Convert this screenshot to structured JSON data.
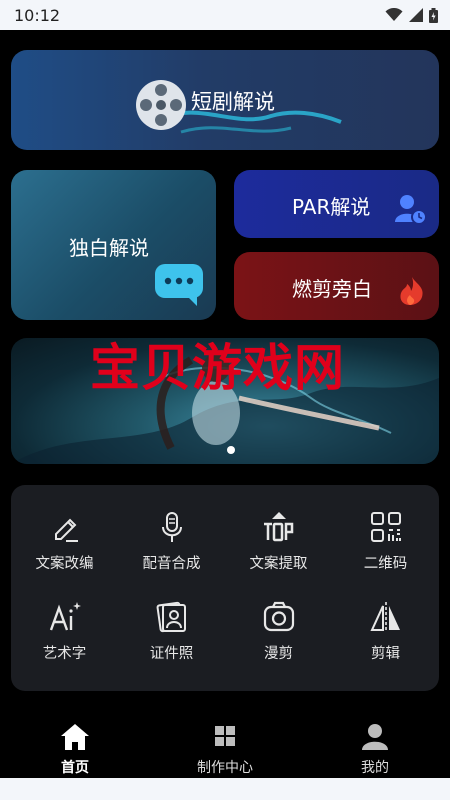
{
  "status": {
    "time": "10:12"
  },
  "cards": {
    "hero": "短剧解说",
    "mono": "独白解说",
    "par": "PAR解说",
    "burn": "燃剪旁白"
  },
  "banner": {
    "watermark": "宝贝游戏网"
  },
  "tools": [
    {
      "label": "文案改编",
      "icon": "pencil-icon"
    },
    {
      "label": "配音合成",
      "icon": "microphone-icon"
    },
    {
      "label": "文案提取",
      "icon": "top-icon"
    },
    {
      "label": "二维码",
      "icon": "qr-code-icon"
    },
    {
      "label": "艺术字",
      "icon": "ai-sparkle-icon"
    },
    {
      "label": "证件照",
      "icon": "id-photo-icon"
    },
    {
      "label": "漫剪",
      "icon": "camera-icon"
    },
    {
      "label": "剪辑",
      "icon": "mirror-icon"
    }
  ],
  "tabbar": [
    {
      "label": "首页",
      "active": true
    },
    {
      "label": "制作中心",
      "active": false
    },
    {
      "label": "我的",
      "active": false
    }
  ],
  "colors": {
    "accent_blue": "#1d2b9c",
    "accent_red": "#7b1316",
    "watermark": "#e0001b"
  }
}
